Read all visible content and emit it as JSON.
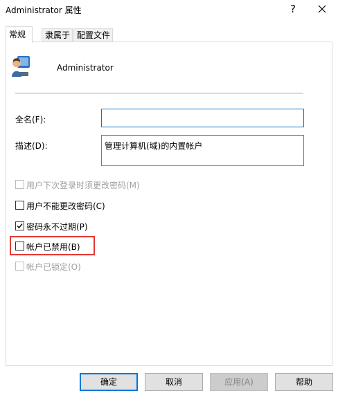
{
  "window": {
    "title": "Administrator 属性",
    "help_glyph": "?",
    "close_icon": "close-icon"
  },
  "tabs": [
    {
      "label": "常规",
      "active": true
    },
    {
      "label": "隶属于",
      "active": false
    },
    {
      "label": "配置文件",
      "active": false
    }
  ],
  "general": {
    "user_icon": "user-account-icon",
    "username": "Administrator",
    "fullname_label": "全名(F):",
    "fullname_value": "",
    "description_label": "描述(D):",
    "description_value": "管理计算机(域)的内置帐户"
  },
  "checkboxes": [
    {
      "label": "用户下次登录时须更改密码(M)",
      "checked": false,
      "disabled": true
    },
    {
      "label": "用户不能更改密码(C)",
      "checked": false,
      "disabled": false
    },
    {
      "label": "密码永不过期(P)",
      "checked": true,
      "disabled": false
    },
    {
      "label": "帐户已禁用(B)",
      "checked": false,
      "disabled": false,
      "highlighted": true
    },
    {
      "label": "帐户已锁定(O)",
      "checked": false,
      "disabled": true
    }
  ],
  "buttons": {
    "ok": "确定",
    "cancel": "取消",
    "apply": "应用(A)",
    "help": "帮助"
  },
  "colors": {
    "accent": "#0078d7",
    "highlight": "#e53935",
    "disabled_text": "#a0a0a0"
  }
}
